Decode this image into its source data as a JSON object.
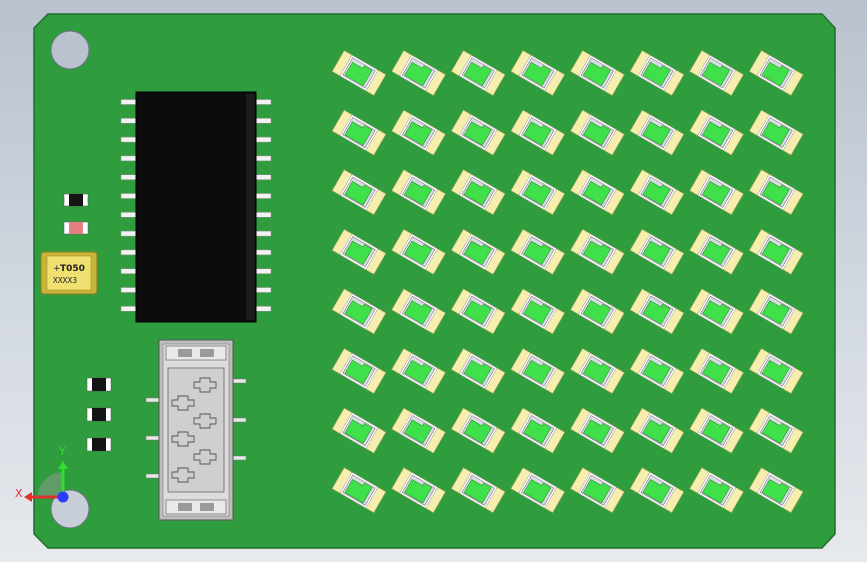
{
  "viewport": {
    "background": "#c8d0da",
    "board_color": "#2f9d3e",
    "board_edge_color": "#257d32"
  },
  "components": {
    "ic": {
      "pins_per_side": 12,
      "body_color": "#0b0b0b",
      "pin_color": "#f2f2f2"
    },
    "capacitor": {
      "marking_line1": "+",
      "marking_line2": "T050",
      "marking_line3": "XXXX3",
      "body_color": "#e9d64f"
    },
    "connector": {
      "body_color": "#d4d4d4"
    },
    "led_array": {
      "rows": 8,
      "cols": 8,
      "led_color": "#3fe04a",
      "pad_color": "#f6eeae",
      "body_color": "#ffffff"
    }
  },
  "axes": {
    "x_label": "X",
    "y_label": "Y",
    "x_color": "#e03030",
    "y_color": "#2ee02e",
    "z_color": "#2a3cff"
  }
}
